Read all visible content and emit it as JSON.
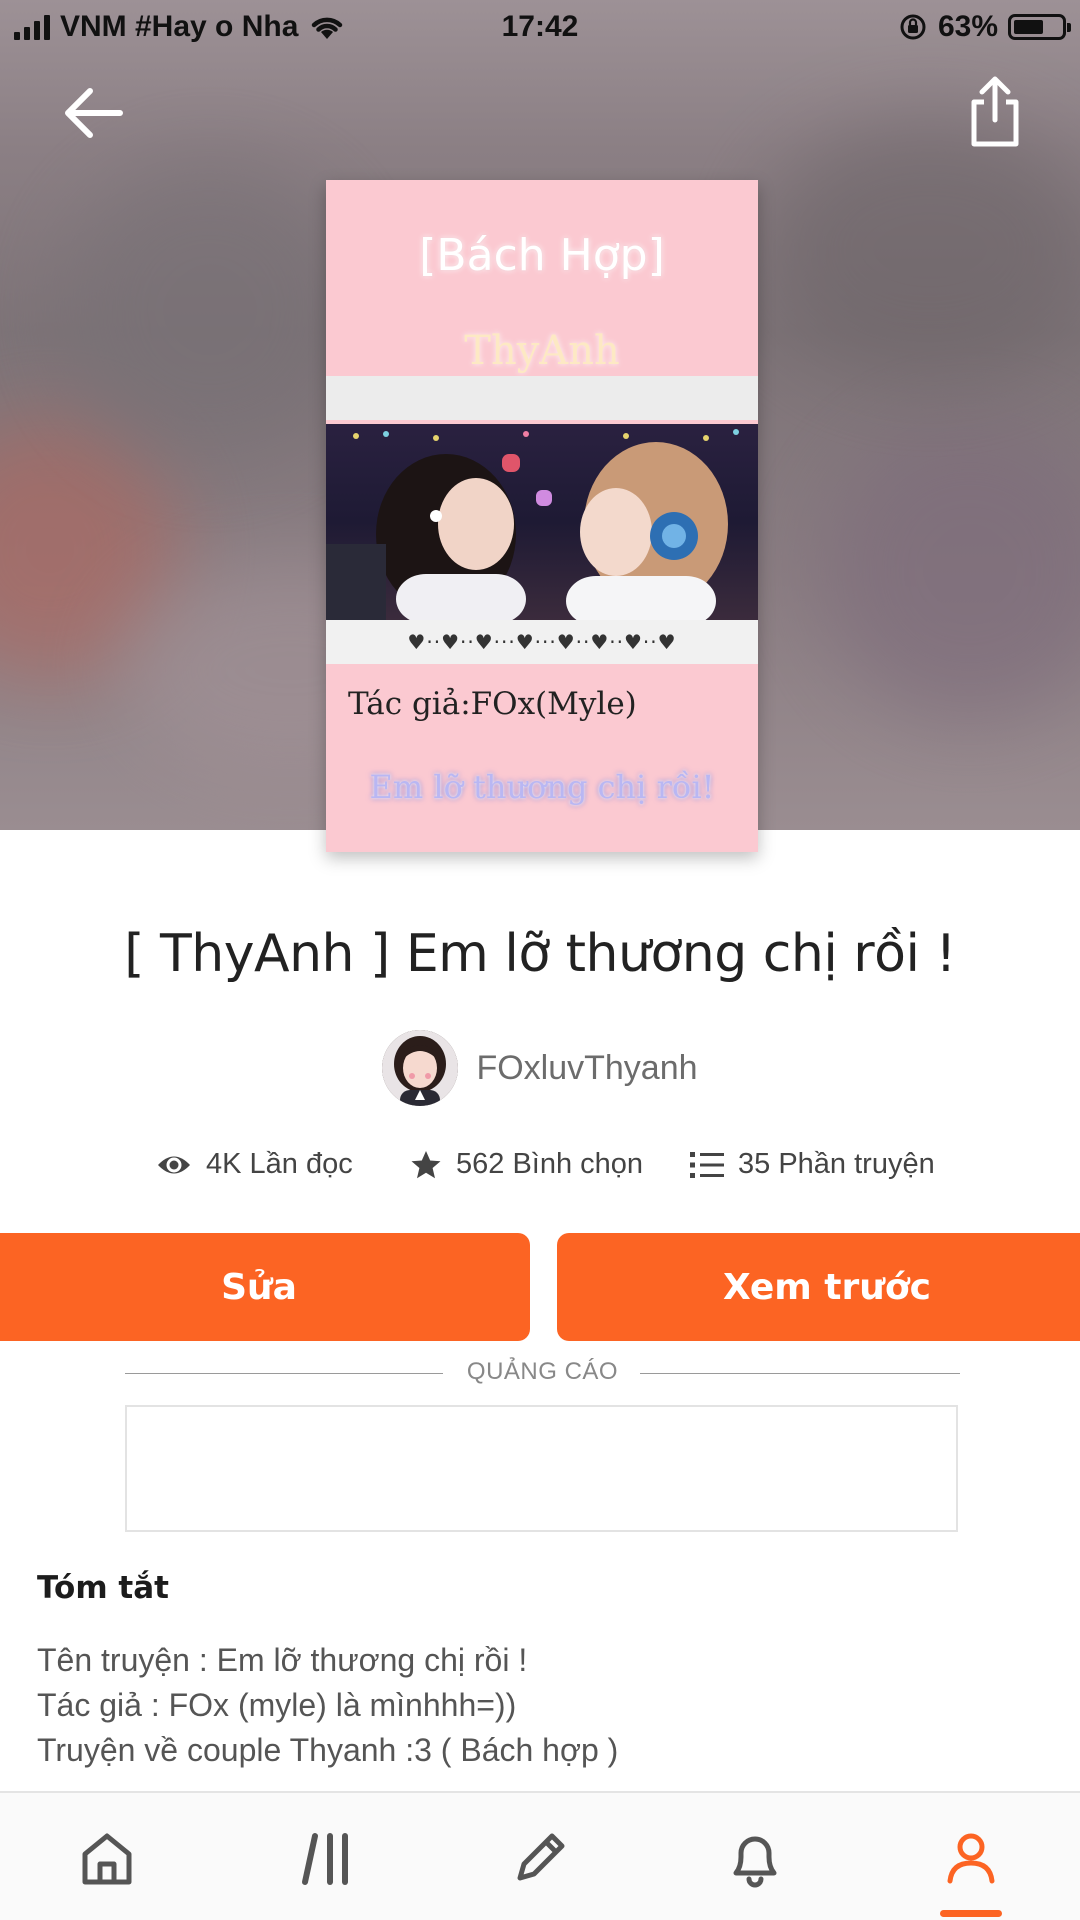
{
  "status_bar": {
    "carrier": "VNM #Hay o Nha",
    "time": "17:42",
    "battery_percent": "63%",
    "battery_level": 0.63
  },
  "header": {
    "back_icon": "arrow-left-icon",
    "share_icon": "share-icon"
  },
  "cover": {
    "genre": "[Bách Hợp]",
    "name": "ThyAnh",
    "hearts": "♥··♥··♥···♥···♥··♥··♥··♥",
    "author": "Tác giả:FOx(Myle)",
    "tagline": "Em lỡ thương chị rồi!"
  },
  "story": {
    "title": "[ ThyAnh ] Em lỡ thương chị rồi !",
    "author_name": "FOxluvThyanh"
  },
  "stats": {
    "reads": "4K Lần đọc",
    "votes": "562 Bình chọn",
    "parts": "35 Phần truyện"
  },
  "actions": {
    "edit_label": "Sửa",
    "preview_label": "Xem trước"
  },
  "ad": {
    "label": "QUẢNG CÁO"
  },
  "summary": {
    "heading": "Tóm tắt",
    "lines": [
      "Tên truyện : Em lỡ thương chị rồi !",
      "Tác giả : FOx (myle) là mìnhhh=))",
      "Truyện về couple Thyanh :3 ( Bách hợp )"
    ]
  },
  "nav": {
    "items": [
      "home-icon",
      "library-icon",
      "write-icon",
      "notifications-icon",
      "profile-icon"
    ],
    "active": "profile-icon",
    "accent_color": "#fc6423"
  },
  "colors": {
    "accent": "#fc6423"
  }
}
